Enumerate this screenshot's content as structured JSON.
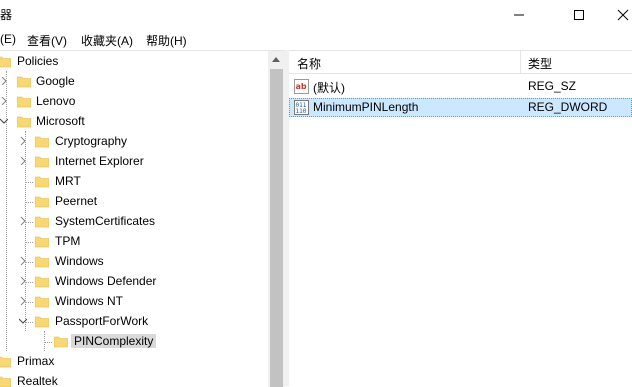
{
  "window": {
    "title": "器"
  },
  "menu": [
    "(E)",
    "查看(V)",
    "收藏夹(A)",
    "帮助(H)"
  ],
  "tree": {
    "items": [
      {
        "label": "Policies"
      },
      {
        "label": "Google"
      },
      {
        "label": "Lenovo"
      },
      {
        "label": "Microsoft"
      },
      {
        "label": "Cryptography"
      },
      {
        "label": "Internet Explorer"
      },
      {
        "label": "MRT"
      },
      {
        "label": "Peernet"
      },
      {
        "label": "SystemCertificates"
      },
      {
        "label": "TPM"
      },
      {
        "label": "Windows"
      },
      {
        "label": "Windows Defender"
      },
      {
        "label": "Windows NT"
      },
      {
        "label": "PassportForWork"
      },
      {
        "label": "PINComplexity"
      },
      {
        "label": "Primax"
      },
      {
        "label": "Realtek"
      }
    ]
  },
  "list": {
    "columns": [
      "名称",
      "类型"
    ],
    "rows": [
      {
        "name": "(默认)",
        "type": "REG_SZ",
        "icon": "string-value-icon"
      },
      {
        "name": "MinimumPINLength",
        "type": "REG_DWORD",
        "icon": "binary-value-icon"
      }
    ]
  },
  "colors": {
    "folder": "#f8d775",
    "selection": "#cce8ff",
    "tree_selection": "#d9d9d9"
  }
}
